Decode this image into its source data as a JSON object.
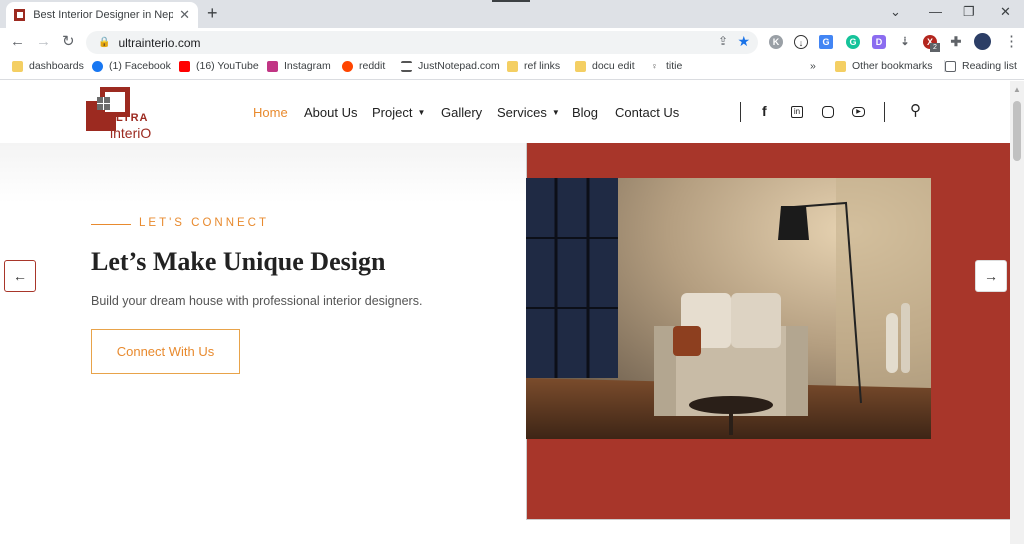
{
  "browser": {
    "tab_title": "Best Interior Designer in Nepal | U",
    "url": "ultrainterio.com",
    "bookmarks": [
      {
        "label": "dashboards",
        "icon": "folder-icon"
      },
      {
        "label": "(1) Facebook",
        "icon": "facebook-icon"
      },
      {
        "label": "(16) YouTube",
        "icon": "youtube-icon"
      },
      {
        "label": "Instagram",
        "icon": "instagram-icon"
      },
      {
        "label": "reddit",
        "icon": "reddit-icon"
      },
      {
        "label": "JustNotepad.com",
        "icon": "notepad-icon"
      },
      {
        "label": "ref links",
        "icon": "folder-icon"
      },
      {
        "label": "docu edit",
        "icon": "folder-icon"
      },
      {
        "label": "titie",
        "icon": "bulb-icon"
      }
    ],
    "other_bookmarks": "Other bookmarks",
    "reading_list": "Reading list",
    "more_bookmarks": "»",
    "ext_badge": "2"
  },
  "site": {
    "logo_top": "ULTRA",
    "logo_bottom": "interiO",
    "nav": [
      {
        "label": "Home",
        "active": true
      },
      {
        "label": "About Us"
      },
      {
        "label": "Project",
        "dropdown": true
      },
      {
        "label": "Gallery"
      },
      {
        "label": "Services",
        "dropdown": true
      },
      {
        "label": "Blog"
      },
      {
        "label": "Contact Us"
      }
    ],
    "hero": {
      "eyebrow": "LET'S CONNECT",
      "headline": "Let’s Make Unique Design",
      "subtext": "Build your dream house with professional interior designers.",
      "cta": "Connect With Us"
    },
    "colors": {
      "accent": "#e88a2e",
      "brand_red": "#a8362a"
    }
  }
}
